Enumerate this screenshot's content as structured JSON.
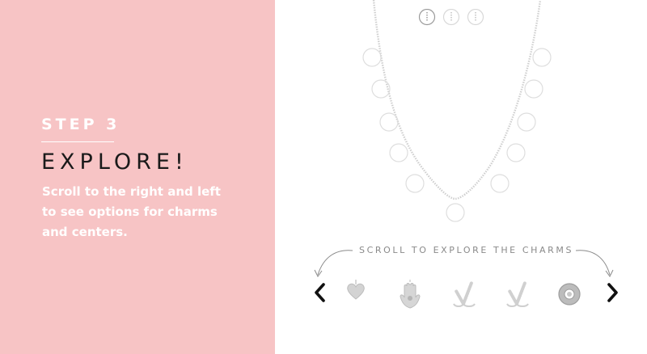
{
  "step": {
    "label": "STEP 3",
    "title": "EXPLORE!",
    "description": "Scroll to the right and left to see options for charms and centers."
  },
  "carousel": {
    "hint": "SCROLL TO EXPLORE THE CHARMS",
    "charms": [
      {
        "name": "heart-charm"
      },
      {
        "name": "hamsa-charm"
      },
      {
        "name": "wishbone-charm"
      },
      {
        "name": "wishbone-charm"
      },
      {
        "name": "medallion-charm"
      }
    ]
  },
  "colors": {
    "panel": "#f7c4c5",
    "text_white": "#ffffff",
    "text_dark": "#1a1a1a",
    "hint": "#8a8a8a"
  }
}
